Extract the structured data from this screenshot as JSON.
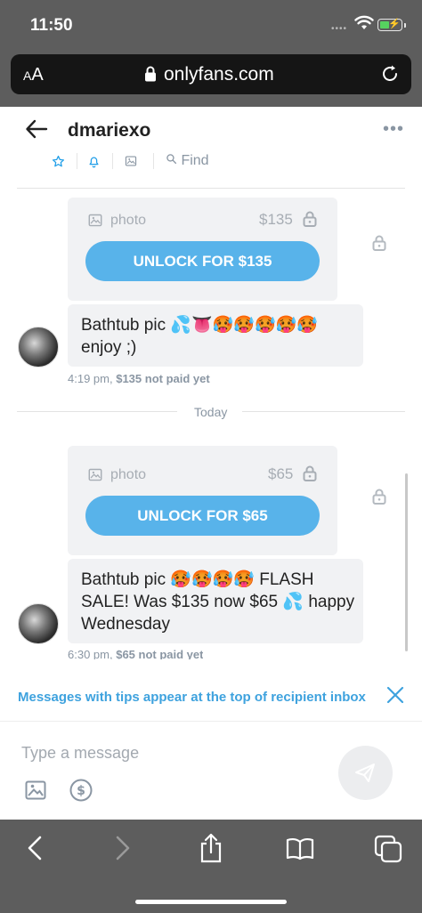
{
  "status_bar": {
    "time": "11:50",
    "signal": "••••"
  },
  "browser": {
    "aa_label_small": "A",
    "aa_label_large": "A",
    "url": "onlyfans.com"
  },
  "chat": {
    "username": "dmariexo",
    "more_label": "•••",
    "find_label": "Find",
    "messages": [
      {
        "media_label": "photo",
        "price": "$135",
        "unlock_label": "UNLOCK FOR $135",
        "text_line1": "Bathtub pic 💦👅🥵🥵🥵🥵🥵",
        "text_line2": "enjoy ;)",
        "time": "4:19 pm,",
        "status": "$135 not paid yet"
      },
      {
        "media_label": "photo",
        "price": "$65",
        "unlock_label": "UNLOCK FOR $65",
        "text_line1": "Bathtub pic 🥵🥵🥵🥵 FLASH",
        "text_line2": "SALE! Was $135 now $65 💦 happy",
        "text_line3": "Wednesday",
        "time": "6:30 pm,",
        "status": "$65 not paid yet"
      }
    ],
    "day_divider": "Today",
    "tip_notice": "Messages with tips appear at the top of recipient inbox",
    "composer": {
      "placeholder": "Type a message",
      "value": ""
    }
  },
  "colors": {
    "accent": "#1f9ee8",
    "unlock_button": "#58b3ea",
    "chrome": "#5d5d5d"
  },
  "icons": [
    "star-icon",
    "bell-icon",
    "image-icon",
    "search-icon",
    "lock-icon",
    "send-icon",
    "dollar-icon",
    "back-arrow-icon"
  ]
}
